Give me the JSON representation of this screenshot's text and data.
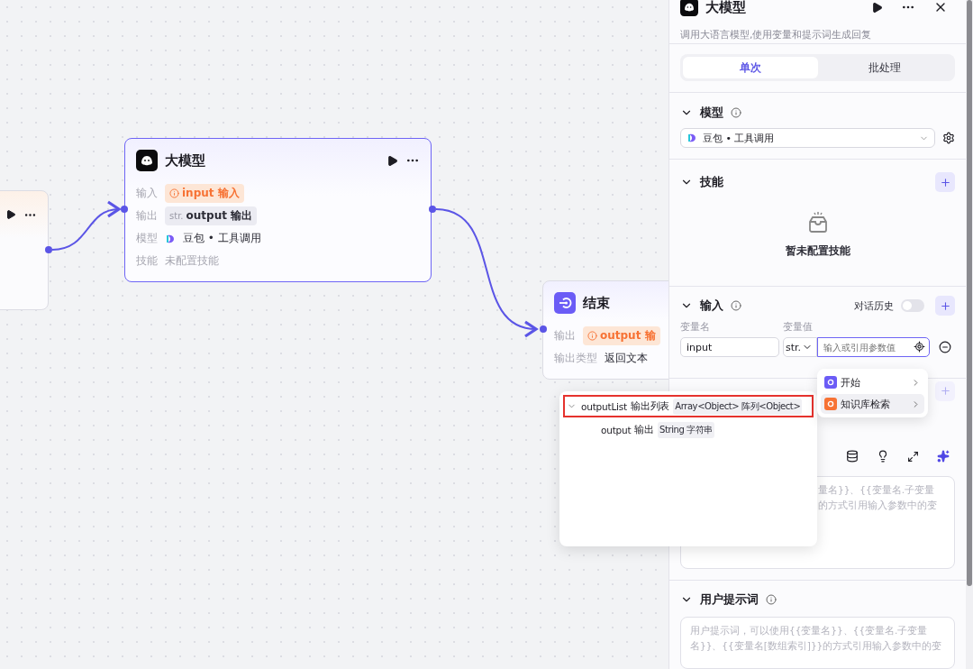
{
  "llm_node": {
    "title": "大模型",
    "rows": [
      {
        "label": "输入",
        "kind": "ref",
        "tag": "input 输入"
      },
      {
        "label": "输出",
        "kind": "typed",
        "type": "str.",
        "tag": "output 输出"
      },
      {
        "label": "模型",
        "kind": "model",
        "value": "豆包 • 工具调用"
      },
      {
        "label": "技能",
        "kind": "empty",
        "value": "未配置技能"
      }
    ]
  },
  "end_node": {
    "title": "结束",
    "rows": [
      {
        "label": "输出",
        "kind": "ref",
        "tag": "output 输"
      },
      {
        "label": "输出类型",
        "kind": "text",
        "value": "返回文本"
      }
    ]
  },
  "panel": {
    "title": "大模型",
    "description": "调用大语言模型,使用变量和提示词生成回复",
    "tabs": [
      {
        "label": "单次",
        "selected": true
      },
      {
        "label": "批处理",
        "selected": false
      }
    ],
    "model_section": {
      "title": "模型",
      "model": "豆包 • 工具调用"
    },
    "skills_section": {
      "title": "技能",
      "empty": "暂未配置技能"
    },
    "input_section": {
      "title": "输入",
      "history_label": "对话历史",
      "history_on": false,
      "columns": [
        "变量名",
        "变量值"
      ],
      "rows": [
        {
          "name": "input",
          "type": "str.",
          "placeholder": "输入或引用参数值"
        }
      ]
    },
    "system_prompt": {
      "placeholder_lines": [
        "量名}}、{{变量名.子变量",
        "的方式引用输入参数中的变"
      ]
    },
    "user_prompt": {
      "title": "用户提示词",
      "placeholder_lines": [
        "用户提示词，可以使用{{变量名}}、{{变量名.子变量",
        "名}}、{{变量名[数组索引]}}的方式引用输入参数中的变"
      ]
    }
  },
  "variable_tree": [
    {
      "name": "outputList",
      "label": "输出列表",
      "type": "Array<Object> 阵列<Object>",
      "expanded": true,
      "selected": true,
      "children": [
        {
          "name": "output",
          "label": "输出",
          "type": "String 字符串",
          "selected": false
        }
      ]
    }
  ],
  "source_menu": [
    {
      "label": "开始",
      "color": "#6b5cf6",
      "selected": false
    },
    {
      "label": "知识库检索",
      "color": "#f77234",
      "selected": true
    }
  ]
}
